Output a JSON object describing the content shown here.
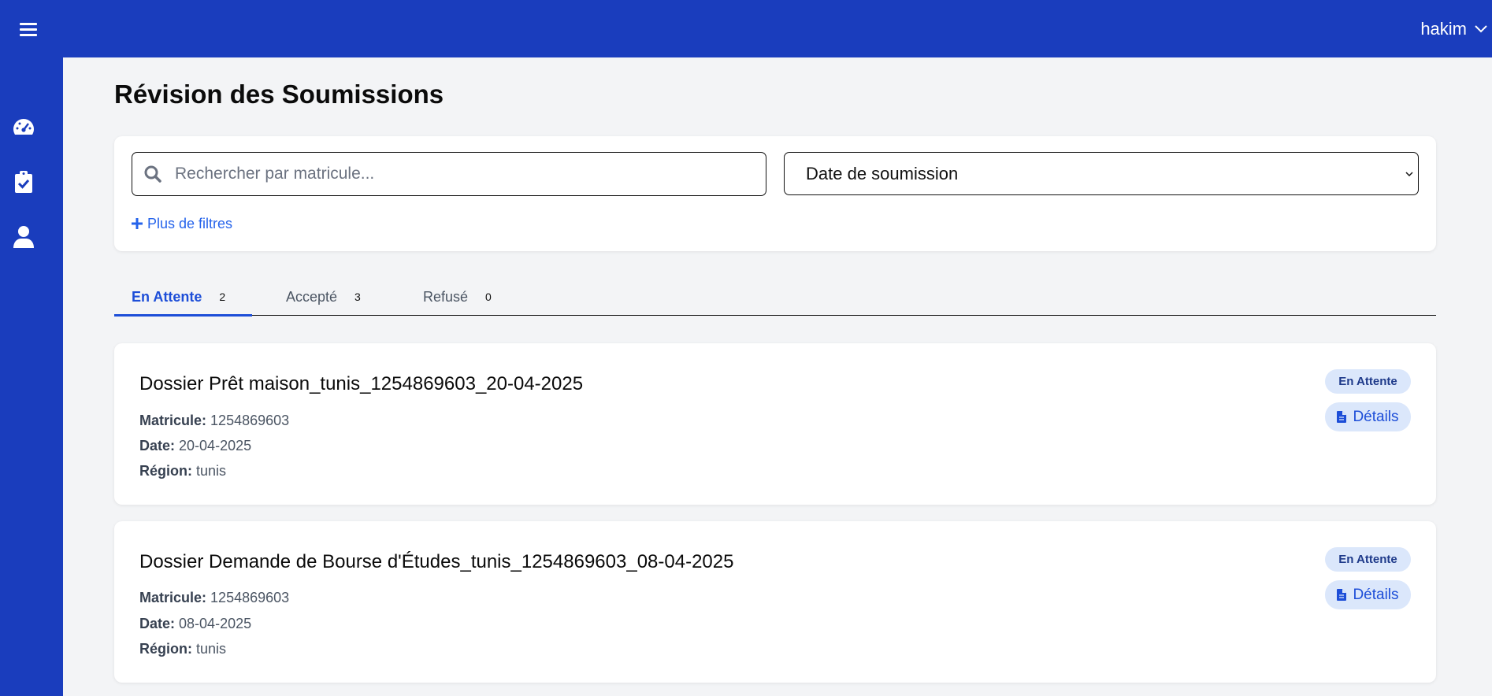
{
  "header": {
    "menu_icon": "hamburger-icon",
    "user_name": "hakim",
    "user_chevron_icon": "chevron-down-icon"
  },
  "sidebar": {
    "items": [
      {
        "icon": "dashboard-gauge-icon"
      },
      {
        "icon": "clipboard-check-icon"
      },
      {
        "icon": "user-icon"
      }
    ]
  },
  "page": {
    "title": "Révision des Soumissions"
  },
  "filters": {
    "search_placeholder": "Rechercher par matricule...",
    "search_value": "",
    "sort_selected": "Date de soumission",
    "more_filters_label": "Plus de filtres"
  },
  "tabs": [
    {
      "label": "En Attente",
      "count": "2",
      "active": true
    },
    {
      "label": "Accepté",
      "count": "3",
      "active": false
    },
    {
      "label": "Refusé",
      "count": "0",
      "active": false
    }
  ],
  "submissions": [
    {
      "title": "Dossier Prêt maison_tunis_1254869603_20-04-2025",
      "matricule_label": "Matricule:",
      "matricule": "1254869603",
      "date_label": "Date:",
      "date": "20-04-2025",
      "region_label": "Région:",
      "region": "tunis",
      "status": "En Attente",
      "details_label": "Détails"
    },
    {
      "title": "Dossier Demande de Bourse d'Études_tunis_1254869603_08-04-2025",
      "matricule_label": "Matricule:",
      "matricule": "1254869603",
      "date_label": "Date:",
      "date": "08-04-2025",
      "region_label": "Région:",
      "region": "tunis",
      "status": "En Attente",
      "details_label": "Détails"
    }
  ],
  "colors": {
    "brand": "#1a3dbd",
    "accent": "#1d4ed8",
    "badge_bg": "#dbe7fb"
  }
}
